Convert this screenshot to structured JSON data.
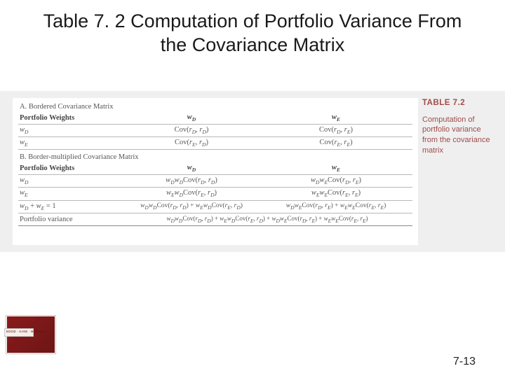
{
  "slide": {
    "title": "Table 7. 2 Computation of Portfolio Variance From the Covariance Matrix",
    "page_number": "7-13"
  },
  "sidebar": {
    "label": "TABLE 7.2",
    "caption": "Computation of portfolio variance from the covariance matrix"
  },
  "table": {
    "sectionA": {
      "heading": "A. Bordered Covariance Matrix",
      "header_c1": "Portfolio Weights",
      "header_c2": "wD",
      "header_c3": "wE",
      "rows": [
        {
          "c1": "wD",
          "c2": "Cov(rD, rD)",
          "c3": "Cov(rD, rE)"
        },
        {
          "c1": "wE",
          "c2": "Cov(rE, rD)",
          "c3": "Cov(rE, rE)"
        }
      ]
    },
    "sectionB": {
      "heading": "B. Border-multiplied Covariance Matrix",
      "header_c1": "Portfolio Weights",
      "header_c2": "wD",
      "header_c3": "wE",
      "rows": [
        {
          "c1": "wD",
          "c2": "wDwDCov(rD, rD)",
          "c3": "wDwECov(rD, rE)"
        },
        {
          "c1": "wE",
          "c2": "wEwDCov(rE, rD)",
          "c3": "wEwECov(rE, rE)"
        },
        {
          "c1": "wD + wE = 1",
          "c2": "wDwDCov(rD, rD) + wEwDCov(rE, rD)",
          "c3": "wDwECov(rD, rE) + wEwECov(rE, rE)"
        },
        {
          "c1": "Portfolio variance",
          "c2_full": "wDwDCov(rD, rD) + wEwDCov(rE, rD) + wDwECov(rD, rE) + wEwECov(rE, rE)"
        }
      ]
    }
  },
  "logo": {
    "authors": "BODIE · KANE · MARCUS"
  },
  "chart_data": {
    "type": "table",
    "title": "Table 7.2 Computation of Portfolio Variance From the Covariance Matrix",
    "sections": [
      {
        "name": "A. Bordered Covariance Matrix",
        "columns": [
          "Portfolio Weights",
          "w_D",
          "w_E"
        ],
        "rows": [
          [
            "w_D",
            "Cov(r_D, r_D)",
            "Cov(r_D, r_E)"
          ],
          [
            "w_E",
            "Cov(r_E, r_D)",
            "Cov(r_E, r_E)"
          ]
        ]
      },
      {
        "name": "B. Border-multiplied Covariance Matrix",
        "columns": [
          "Portfolio Weights",
          "w_D",
          "w_E"
        ],
        "rows": [
          [
            "w_D",
            "w_D w_D Cov(r_D, r_D)",
            "w_D w_E Cov(r_D, r_E)"
          ],
          [
            "w_E",
            "w_E w_D Cov(r_E, r_D)",
            "w_E w_E Cov(r_E, r_E)"
          ],
          [
            "w_D + w_E = 1",
            "w_D w_D Cov(r_D, r_D) + w_E w_D Cov(r_E, r_D)",
            "w_D w_E Cov(r_D, r_E) + w_E w_E Cov(r_E, r_E)"
          ],
          [
            "Portfolio variance",
            "w_D w_D Cov(r_D, r_D) + w_E w_D Cov(r_E, r_D) + w_D w_E Cov(r_D, r_E) + w_E w_E Cov(r_E, r_E)",
            ""
          ]
        ]
      }
    ]
  }
}
